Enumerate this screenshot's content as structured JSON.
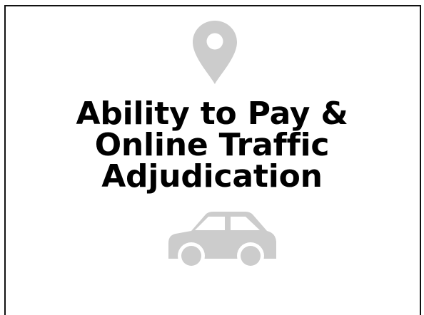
{
  "card": {
    "title_lines": [
      "Ability to Pay &",
      "Online Traffic",
      "Adjudication"
    ],
    "icons": {
      "top": "location-pin-icon",
      "bottom": "car-icon"
    },
    "icon_color": "#cccccc",
    "text_color": "#000000",
    "border_color": "#111111"
  }
}
